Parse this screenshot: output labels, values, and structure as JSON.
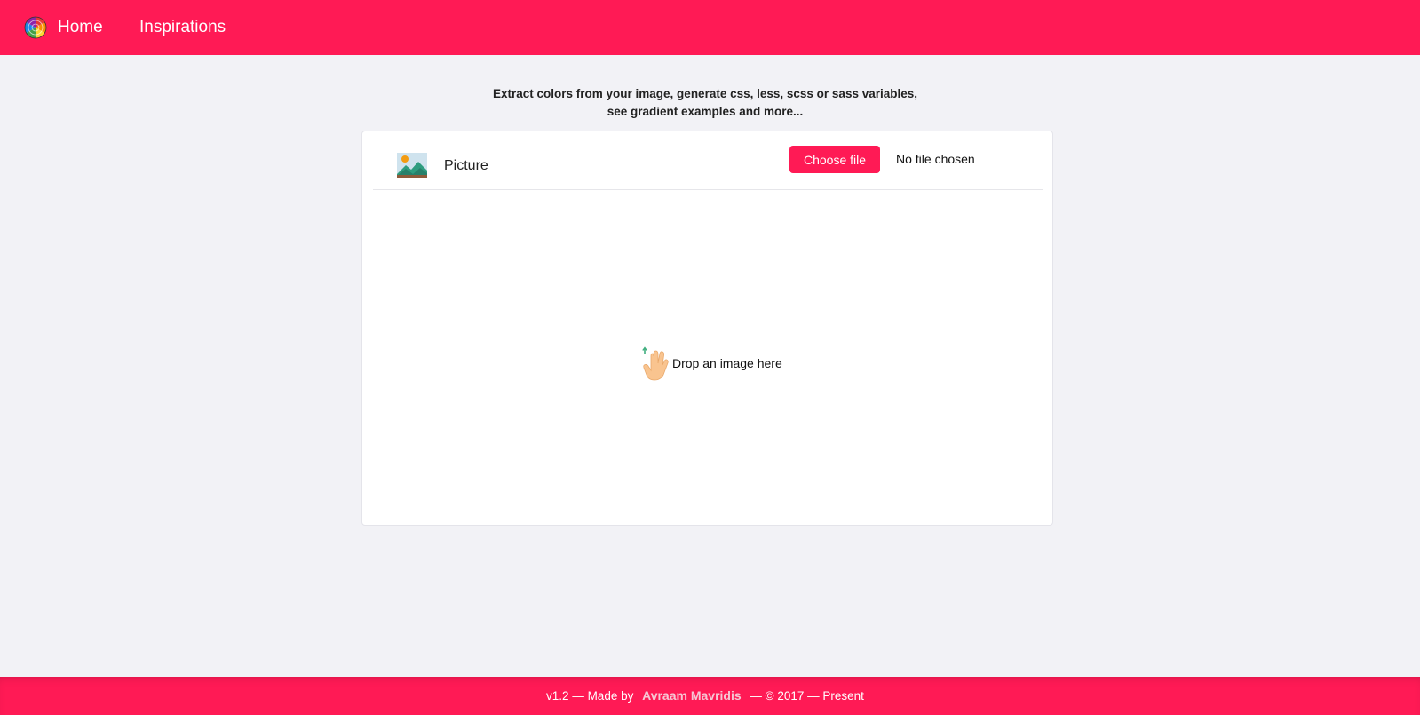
{
  "nav": {
    "home_label": "Home",
    "inspirations_label": "Inspirations",
    "logo_icon": "color-wheel-icon"
  },
  "tagline": {
    "line1": "Extract colors from your image, generate css, less, scss or sass variables,",
    "line2": "see gradient examples and more..."
  },
  "card": {
    "header": {
      "icon": "picture-icon",
      "title": "Picture"
    },
    "file_input": {
      "button_label": "Choose file",
      "status": "No file chosen"
    },
    "drop_zone": {
      "icon": "hand-drop-icon",
      "label": "Drop an image here"
    }
  },
  "footer": {
    "prefix": "v1.2 — Made by",
    "author": "Avraam Mavridis",
    "suffix": "— © 2017 — Present"
  },
  "colors": {
    "brand": "#ff1a55",
    "background": "#f2f2f6",
    "card": "#ffffff"
  }
}
